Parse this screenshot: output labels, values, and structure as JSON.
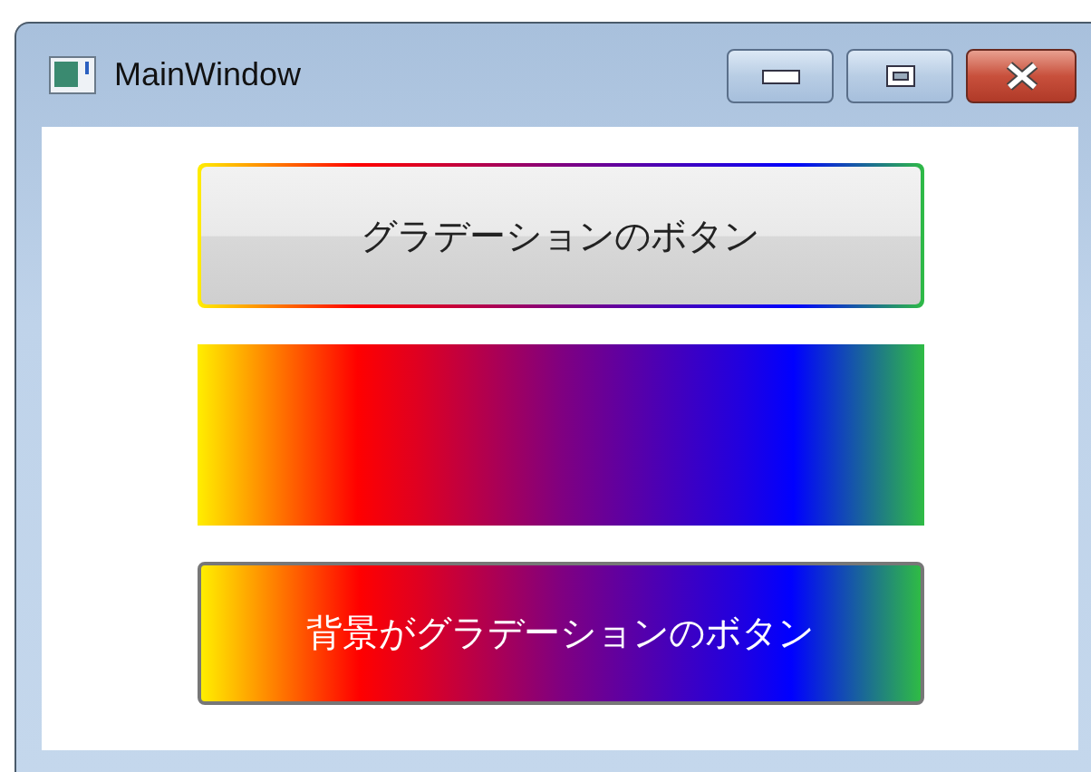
{
  "window": {
    "title": "MainWindow"
  },
  "content": [
    {
      "kind": "border-button",
      "label": "グラデーションのボタン"
    },
    {
      "kind": "gradient-rect"
    },
    {
      "kind": "gradient-button",
      "label": "背景がグラデーションのボタン"
    }
  ]
}
